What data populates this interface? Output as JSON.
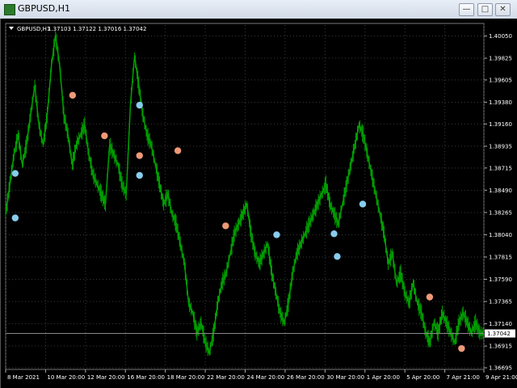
{
  "window": {
    "title": "GBPUSD,H1",
    "buttons": {
      "minimize": "—",
      "maximize": "□",
      "close": "✕"
    }
  },
  "chart_header": {
    "symbol": "GBPUSD,H1",
    "ohlc": "1.37103 1.37122 1.37016 1.37042"
  },
  "colors": {
    "background": "#000000",
    "grid": "#3a3a3a",
    "candles": "#00a000",
    "marker_blue": "#88ccee",
    "marker_orange": "#ee9977",
    "text": "#ffffff"
  },
  "chart_data": {
    "type": "line",
    "title": "GBPUSD,H1",
    "grid": true,
    "y_ticks": [
      "1.40050",
      "1.39825",
      "1.39605",
      "1.39380",
      "1.39160",
      "1.38935",
      "1.38715",
      "1.38490",
      "1.38265",
      "1.38040",
      "1.37815",
      "1.37590",
      "1.37365",
      "1.37140",
      "1.36915",
      "1.36695"
    ],
    "current_price": "1.37042",
    "ylim": [
      1.36695,
      1.4016
    ],
    "x_ticks": [
      {
        "label": "8 Mar 2021",
        "i": 0
      },
      {
        "label": "10 Mar 20:00",
        "i": 48
      },
      {
        "label": "12 Mar 20:00",
        "i": 96
      },
      {
        "label": "16 Mar 20:00",
        "i": 144
      },
      {
        "label": "18 Mar 20:00",
        "i": 192
      },
      {
        "label": "22 Mar 20:00",
        "i": 240
      },
      {
        "label": "24 Mar 20:00",
        "i": 288
      },
      {
        "label": "26 Mar 20:00",
        "i": 336
      },
      {
        "label": "30 Mar 20:00",
        "i": 384
      },
      {
        "label": "1 Apr 20:00",
        "i": 432
      },
      {
        "label": "5 Apr 20:00",
        "i": 480
      },
      {
        "label": "7 Apr 21:00",
        "i": 528
      },
      {
        "label": "9 Apr 21:00",
        "i": 575
      }
    ],
    "series": [
      {
        "x_index": [
          0,
          5,
          10,
          15,
          20,
          25,
          30,
          35,
          40,
          45,
          50,
          55,
          60,
          65,
          70,
          75,
          80,
          85,
          90,
          95,
          100,
          105,
          110,
          115,
          120,
          125,
          130,
          135,
          140,
          145,
          150,
          155,
          160,
          165,
          170,
          175,
          180,
          185,
          190,
          195,
          200,
          205,
          210,
          215,
          220,
          225,
          230,
          235,
          240,
          245,
          250,
          255,
          260,
          265,
          270,
          275,
          280,
          285,
          290,
          295,
          300,
          305,
          310,
          315,
          320,
          325,
          330,
          335,
          340,
          345,
          350,
          355,
          360,
          365,
          370,
          375,
          380,
          385,
          390,
          395,
          400,
          405,
          410,
          415,
          420,
          425,
          430,
          435,
          440,
          445,
          450,
          455,
          460,
          465,
          470,
          475,
          480,
          485,
          490,
          495,
          500,
          505,
          510,
          515,
          520,
          525,
          530,
          535,
          540,
          545,
          550,
          555,
          560,
          565,
          570,
          575
        ],
        "y": [
          1.3825,
          1.3855,
          1.3885,
          1.3905,
          1.3875,
          1.3895,
          1.3925,
          1.3955,
          1.3915,
          1.3895,
          1.3925,
          1.3975,
          1.4005,
          1.3975,
          1.3925,
          1.3905,
          1.3875,
          1.3895,
          1.3905,
          1.3915,
          1.3885,
          1.3865,
          1.3855,
          1.3845,
          1.3835,
          1.3895,
          1.3885,
          1.3875,
          1.3855,
          1.3845,
          1.3935,
          1.3985,
          1.3955,
          1.3925,
          1.3905,
          1.3895,
          1.3875,
          1.3855,
          1.3835,
          1.3845,
          1.3825,
          1.3815,
          1.3795,
          1.3775,
          1.3735,
          1.3725,
          1.3705,
          1.3715,
          1.3695,
          1.3685,
          1.3705,
          1.3735,
          1.3755,
          1.3765,
          1.3785,
          1.3805,
          1.3815,
          1.3825,
          1.3835,
          1.3805,
          1.3785,
          1.3775,
          1.3785,
          1.3795,
          1.3765,
          1.3745,
          1.3725,
          1.3715,
          1.3735,
          1.3765,
          1.3785,
          1.3795,
          1.3805,
          1.3815,
          1.3825,
          1.3835,
          1.3845,
          1.3855,
          1.3835,
          1.3825,
          1.3815,
          1.3835,
          1.3855,
          1.3875,
          1.3895,
          1.3915,
          1.3905,
          1.3885,
          1.3865,
          1.3845,
          1.3825,
          1.3805,
          1.3775,
          1.3785,
          1.3755,
          1.3765,
          1.3745,
          1.3735,
          1.3755,
          1.3735,
          1.3725,
          1.3705,
          1.3695,
          1.3715,
          1.3705,
          1.3725,
          1.3715,
          1.3705,
          1.3695,
          1.3715,
          1.3725,
          1.3715,
          1.3705,
          1.3715,
          1.3705,
          1.3704
        ]
      }
    ],
    "markers": [
      {
        "i": 3,
        "v": 1.3866,
        "color": "blue"
      },
      {
        "i": 3,
        "v": 1.3821,
        "color": "blue"
      },
      {
        "i": 21,
        "v": 1.3945,
        "color": "orange"
      },
      {
        "i": 31,
        "v": 1.3904,
        "color": "orange"
      },
      {
        "i": 42,
        "v": 1.3935,
        "color": "blue"
      },
      {
        "i": 42,
        "v": 1.3884,
        "color": "orange"
      },
      {
        "i": 42,
        "v": 1.3864,
        "color": "blue"
      },
      {
        "i": 54,
        "v": 1.3889,
        "color": "orange"
      },
      {
        "i": 69,
        "v": 1.3813,
        "color": "orange"
      },
      {
        "i": 85,
        "v": 1.3804,
        "color": "blue"
      },
      {
        "i": 103,
        "v": 1.3805,
        "color": "blue"
      },
      {
        "i": 104,
        "v": 1.3782,
        "color": "blue"
      },
      {
        "i": 112,
        "v": 1.3835,
        "color": "blue"
      },
      {
        "i": 133,
        "v": 1.3741,
        "color": "orange"
      },
      {
        "i": 143,
        "v": 1.3689,
        "color": "orange"
      }
    ]
  }
}
